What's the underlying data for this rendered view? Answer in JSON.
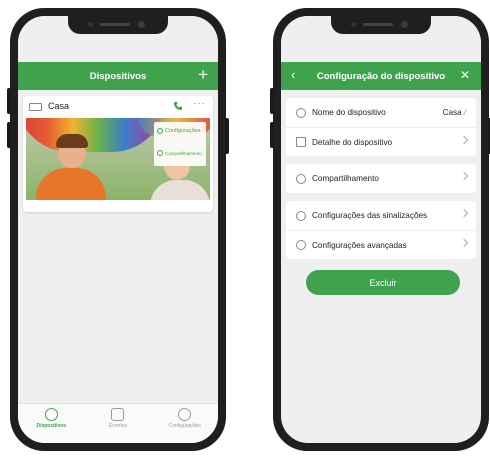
{
  "left_screen": {
    "header": {
      "title": "Dispositivos",
      "add_icon": "plus-icon"
    },
    "card": {
      "device_name": "Casa",
      "camera_icon": "camera-icon",
      "call_icon": "phone-icon",
      "more_icon": "more-icon"
    },
    "popup": {
      "item1": "Configurações",
      "item2": "Compartilhamento"
    },
    "nav": [
      {
        "label": "Dispositivos",
        "icon": "device-icon",
        "active": true
      },
      {
        "label": "Eventos",
        "icon": "message-icon",
        "active": false
      },
      {
        "label": "Configurações",
        "icon": "user-icon",
        "active": false
      }
    ]
  },
  "right_screen": {
    "header": {
      "title": "Configuração do dispositivo",
      "back_icon": "back-icon",
      "close_icon": "close-icon"
    },
    "rows": {
      "nome": {
        "label": "Nome do dispositivo",
        "value": "Casa"
      },
      "detalhe": {
        "label": "Detalhe do dispositivo"
      },
      "compartilhamento": {
        "label": "Compartilhamento"
      },
      "sinalizacoes": {
        "label": "Configurações das sinalizações"
      },
      "avancadas": {
        "label": "Configurações avançadas"
      }
    },
    "delete_button": "Excluir"
  },
  "colors": {
    "accent": "#3fa34d",
    "background": "#efefef"
  }
}
